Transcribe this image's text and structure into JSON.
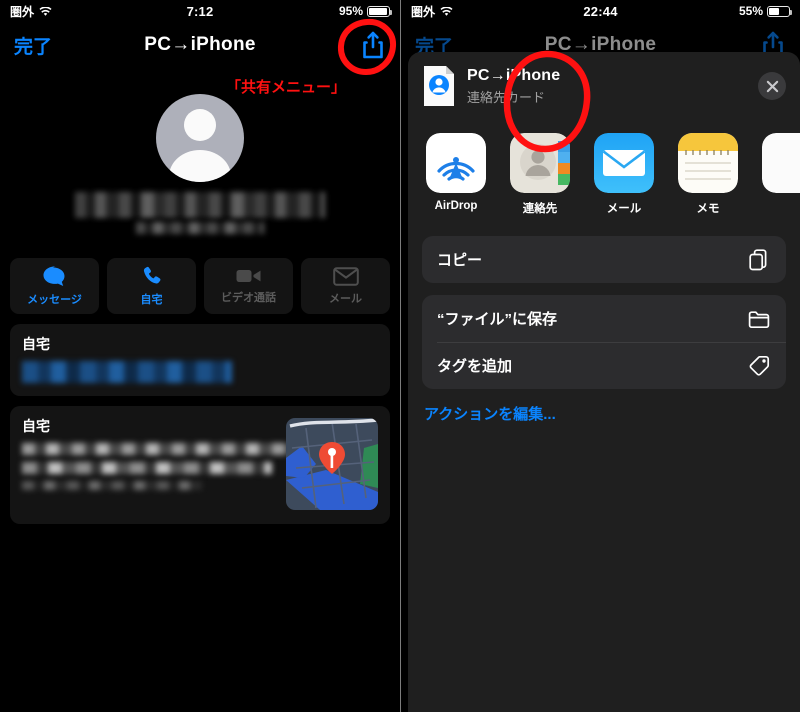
{
  "left": {
    "status": {
      "carrier": "圏外",
      "wifi_icon": "wifi-icon",
      "time": "7:12",
      "battery_text": "95%",
      "battery_level": 95
    },
    "nav": {
      "done_label": "完了",
      "title": "PC→iPhone",
      "share_icon": "share-icon"
    },
    "annotation": {
      "label": "「共有メニュー」",
      "color": "#ff1111"
    },
    "contact": {
      "avatar_icon": "person-avatar-icon",
      "name_redacted": "",
      "subtitle_redacted": ""
    },
    "actions": [
      {
        "label": "メッセージ",
        "icon": "message-bubble-icon",
        "enabled": true
      },
      {
        "label": "自宅",
        "icon": "phone-icon",
        "enabled": true
      },
      {
        "label": "ビデオ通話",
        "icon": "video-camera-icon",
        "enabled": false
      },
      {
        "label": "メール",
        "icon": "envelope-icon",
        "enabled": false
      }
    ],
    "cards": [
      {
        "title": "自宅",
        "value_redacted": "",
        "has_map": false
      },
      {
        "title": "自宅",
        "value_redacted": "",
        "has_map": true,
        "map_icon": "map-pin-icon"
      }
    ]
  },
  "right": {
    "status": {
      "carrier": "圏外",
      "wifi_icon": "wifi-icon",
      "time": "22:44",
      "battery_text": "55%",
      "battery_level": 55
    },
    "nav": {
      "done_label": "完了",
      "title": "PC→iPhone",
      "share_icon": "share-icon"
    },
    "sheet": {
      "doc_icon": "contact-card-document-icon",
      "title": "PC→iPhone",
      "subtitle": "連絡先カード",
      "close_icon": "close-icon",
      "apps": [
        {
          "label": "AirDrop",
          "icon": "airdrop-icon"
        },
        {
          "label": "連絡先",
          "icon": "contacts-app-icon",
          "highlighted": true
        },
        {
          "label": "メール",
          "icon": "mail-app-icon"
        },
        {
          "label": "メモ",
          "icon": "notes-app-icon"
        },
        {
          "label": "",
          "icon": "partial-app-icon"
        }
      ],
      "groups": [
        [
          {
            "label": "コピー",
            "icon": "copy-icon"
          }
        ],
        [
          {
            "label": "“ファイル”に保存",
            "icon": "folder-icon"
          },
          {
            "label": "タグを追加",
            "icon": "tag-icon"
          }
        ]
      ],
      "edit_actions_label": "アクションを編集..."
    },
    "annotation": {
      "color": "#ff1111",
      "target": "連絡先"
    }
  },
  "colors": {
    "accent_blue": "#0a84ff",
    "annotation_red": "#ff1111",
    "sheet_bg": "#1f1f1f",
    "row_bg": "#2c2c2e"
  }
}
